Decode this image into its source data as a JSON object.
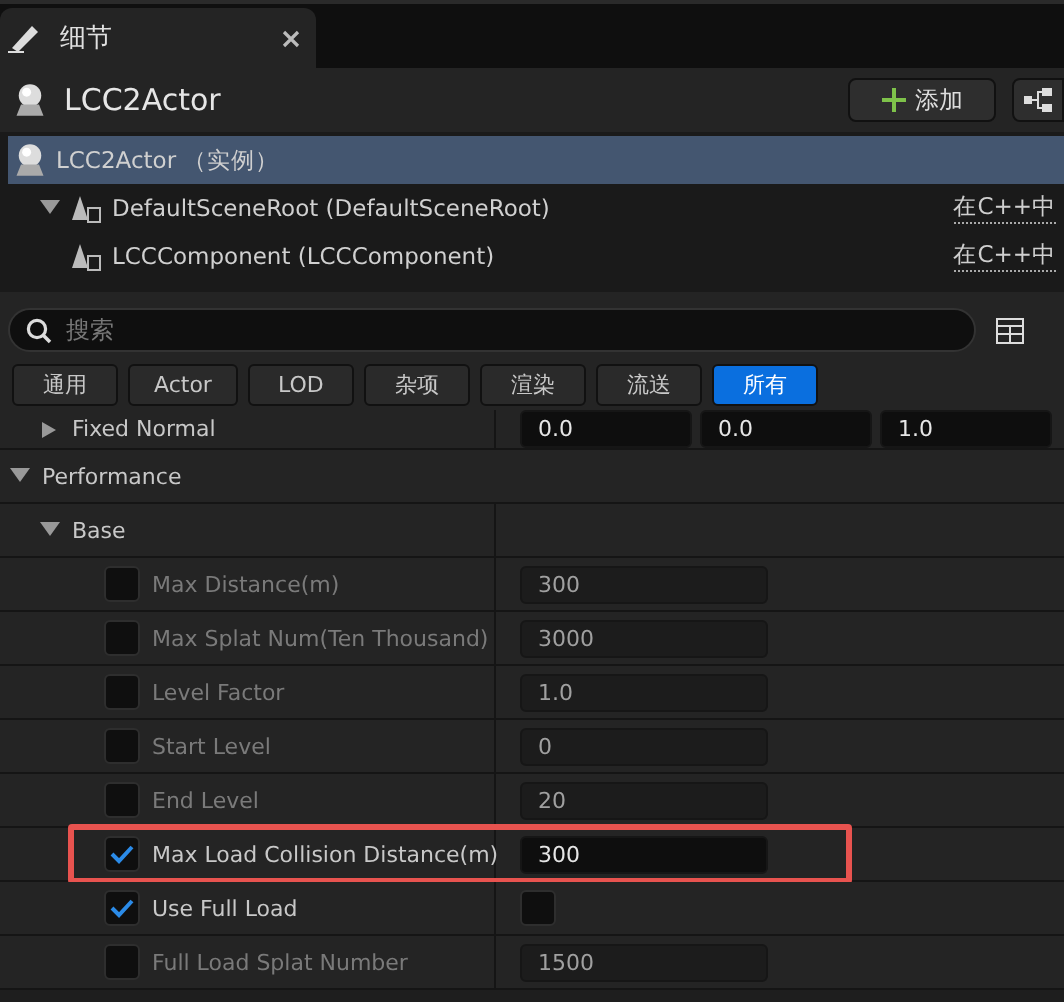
{
  "tab": {
    "title": "细节"
  },
  "header": {
    "title": "LCC2Actor",
    "add_button": "添加"
  },
  "components": [
    {
      "label": "LCC2Actor （实例）",
      "selected": true,
      "children": [
        {
          "label": "DefaultSceneRoot (DefaultSceneRoot)",
          "selected": false,
          "edit_link": "在C++中",
          "expanded": true,
          "children": [
            {
              "label": "LCCComponent (LCCComponent)",
              "selected": false,
              "edit_link": "在C++中"
            }
          ]
        }
      ]
    }
  ],
  "search": {
    "placeholder": "搜索"
  },
  "filters": [
    {
      "label": "通用",
      "selected": false
    },
    {
      "label": "Actor",
      "selected": false
    },
    {
      "label": "LOD",
      "selected": false
    },
    {
      "label": "杂项",
      "selected": false
    },
    {
      "label": "渲染",
      "selected": false
    },
    {
      "label": "流送",
      "selected": false
    },
    {
      "label": "所有",
      "selected": true
    }
  ],
  "partial_row": {
    "label": "Fixed Normal",
    "values": [
      "0.0",
      "0.0",
      "1.0"
    ]
  },
  "category": {
    "title": "Performance",
    "expanded": true
  },
  "subcategory": {
    "title": "Base",
    "expanded": true
  },
  "properties": [
    {
      "label": "Max Distance(m)",
      "enabled": false,
      "kind": "number",
      "value": "300",
      "highlighted": false
    },
    {
      "label": "Max Splat Num(Ten Thousand)",
      "enabled": false,
      "kind": "number",
      "value": "3000",
      "highlighted": false
    },
    {
      "label": "Level Factor",
      "enabled": false,
      "kind": "number",
      "value": "1.0",
      "highlighted": false
    },
    {
      "label": "Start Level",
      "enabled": false,
      "kind": "number",
      "value": "0",
      "highlighted": false
    },
    {
      "label": "End Level",
      "enabled": false,
      "kind": "number",
      "value": "20",
      "highlighted": false
    },
    {
      "label": "Max Load Collision Distance(m)",
      "enabled": true,
      "kind": "number",
      "value": "300",
      "highlighted": true
    },
    {
      "label": "Use Full Load",
      "enabled": true,
      "kind": "checkbox",
      "checked": false,
      "highlighted": false
    },
    {
      "label": "Full Load Splat Number",
      "enabled": false,
      "kind": "number",
      "value": "1500",
      "highlighted": false
    }
  ]
}
